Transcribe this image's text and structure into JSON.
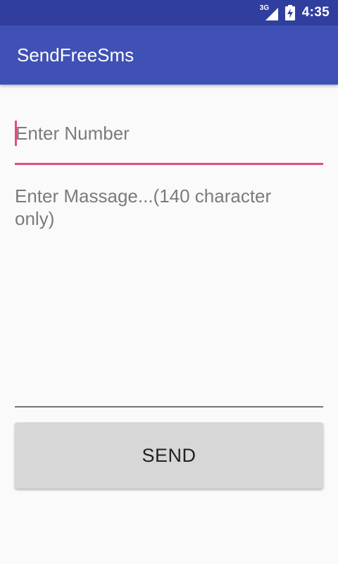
{
  "status_bar": {
    "network_type": "3G",
    "time": "4:35",
    "icons": [
      "signal-icon",
      "battery-icon"
    ]
  },
  "app_bar": {
    "title": "SendFreeSms"
  },
  "form": {
    "number_placeholder": "Enter Number",
    "message_placeholder": "Enter Massage...(140 character only)",
    "send_label": "SEND"
  },
  "colors": {
    "status_bar": "#303f9f",
    "app_bar": "#3f51b5",
    "accent": "#e84a7f",
    "button_background": "#d7d7d7",
    "page_background": "#fafafa"
  }
}
